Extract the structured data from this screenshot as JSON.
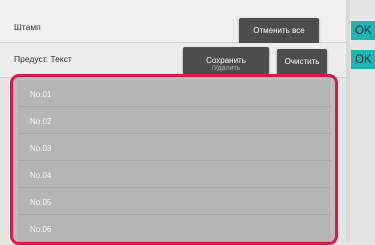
{
  "stamp_row": {
    "label": "Штамп",
    "cancel_all_label": "Отменить все",
    "ok_label": "OK"
  },
  "preset_row": {
    "label": "Предуст. Текст",
    "save_label": "Сохранить",
    "save_sublabel": "/Удалить",
    "clear_label": "Очистить",
    "ok_label": "OK"
  },
  "list": {
    "items": [
      {
        "label": "No.01"
      },
      {
        "label": "No.02"
      },
      {
        "label": "No.03"
      },
      {
        "label": "No.04"
      },
      {
        "label": "No.05"
      },
      {
        "label": "No.06"
      }
    ]
  },
  "colors": {
    "highlight_border": "#d61b4b",
    "ok_button": "#1ab6b2",
    "dark_button": "#4d4d4d",
    "list_bg": "#b4b4b4"
  }
}
